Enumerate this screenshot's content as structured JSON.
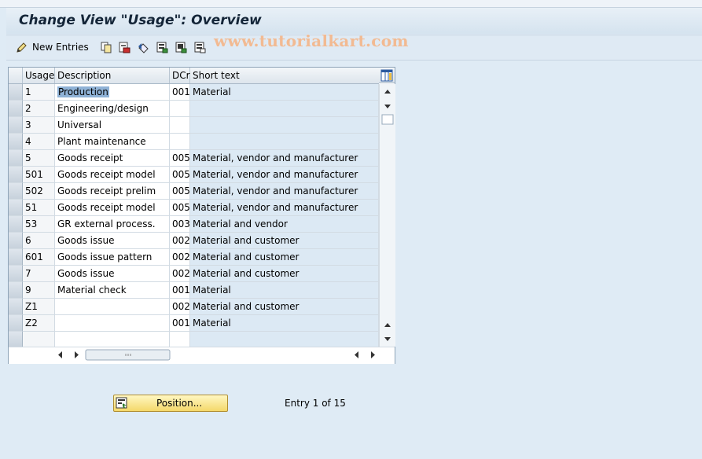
{
  "title": "Change View \"Usage\": Overview",
  "toolbar": {
    "new_entries_label": "New Entries",
    "icons": [
      "copy-icon",
      "delete-icon",
      "undo-icon",
      "select-all-icon",
      "select-block-icon",
      "deselect-all-icon"
    ]
  },
  "watermark": "www.tutorialkart.com",
  "table": {
    "columns": [
      "Usage",
      "Description",
      "DCr",
      "Short text"
    ],
    "rows": [
      {
        "usage": "1",
        "desc": "Production",
        "dcr": "001",
        "short": "Material"
      },
      {
        "usage": "2",
        "desc": "Engineering/design",
        "dcr": "",
        "short": ""
      },
      {
        "usage": "3",
        "desc": "Universal",
        "dcr": "",
        "short": ""
      },
      {
        "usage": "4",
        "desc": "Plant maintenance",
        "dcr": "",
        "short": ""
      },
      {
        "usage": "5",
        "desc": "Goods receipt",
        "dcr": "005",
        "short": "Material, vendor and manufacturer"
      },
      {
        "usage": "501",
        "desc": "Goods receipt model",
        "dcr": "005",
        "short": "Material, vendor and manufacturer"
      },
      {
        "usage": "502",
        "desc": "Goods receipt prelim",
        "dcr": "005",
        "short": "Material, vendor and manufacturer"
      },
      {
        "usage": "51",
        "desc": "Goods receipt model",
        "dcr": "005",
        "short": "Material, vendor and manufacturer"
      },
      {
        "usage": "53",
        "desc": "GR external process.",
        "dcr": "003",
        "short": "Material and vendor"
      },
      {
        "usage": "6",
        "desc": "Goods issue",
        "dcr": "002",
        "short": "Material and customer"
      },
      {
        "usage": "601",
        "desc": "Goods issue pattern",
        "dcr": "002",
        "short": "Material and customer"
      },
      {
        "usage": "7",
        "desc": "Goods issue",
        "dcr": "002",
        "short": "Material and customer"
      },
      {
        "usage": "9",
        "desc": "Material check",
        "dcr": "001",
        "short": "Material"
      },
      {
        "usage": "Z1",
        "desc": "",
        "dcr": "002",
        "short": "Material and customer"
      },
      {
        "usage": "Z2",
        "desc": "",
        "dcr": "001",
        "short": "Material"
      },
      {
        "usage": "",
        "desc": "",
        "dcr": "",
        "short": ""
      }
    ]
  },
  "position_button_label": "Position...",
  "entry_info": "Entry 1 of 15",
  "colors": {
    "background": "#dfebf5",
    "short_text_column": "#dce9f4",
    "selection_highlight": "#8fb2d6",
    "button_yellow": "#f4d86a",
    "watermark": "#f2ba92"
  }
}
